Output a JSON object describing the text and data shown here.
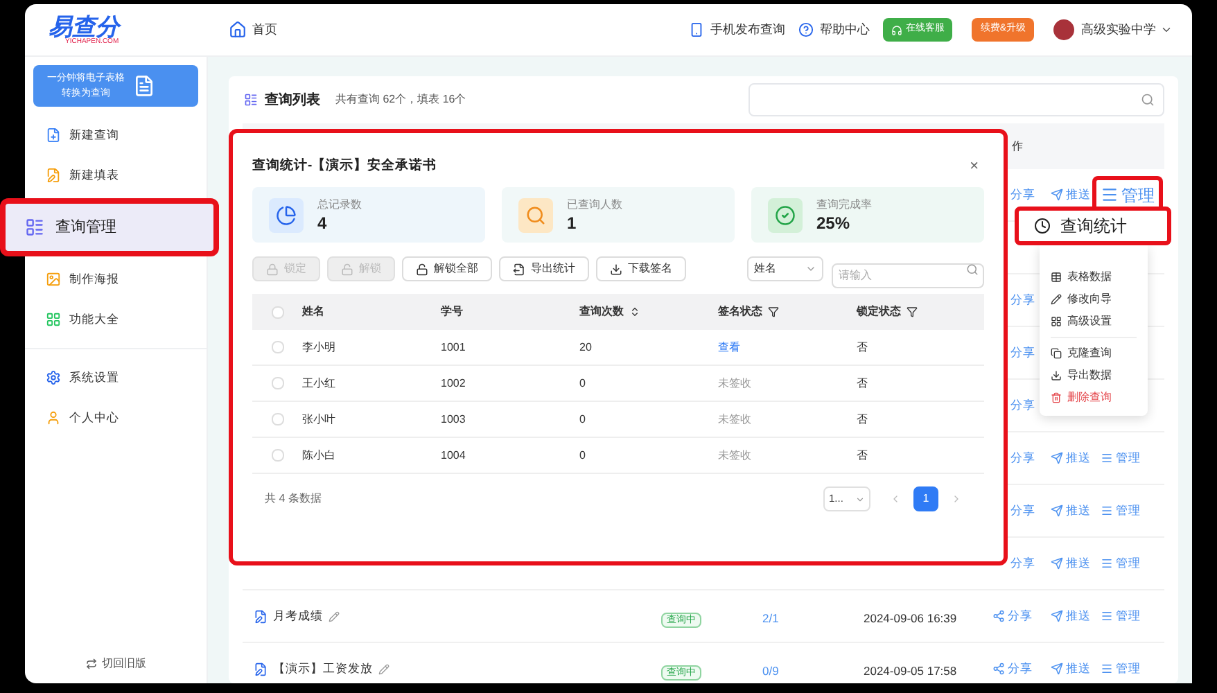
{
  "header": {
    "logo": {
      "name": "易查分",
      "domain": "YICHAPEN.COM"
    },
    "breadcrumb": "首页",
    "links": [
      {
        "label": "手机发布查询",
        "kind": "phone"
      },
      {
        "label": "帮助中心",
        "kind": "help"
      }
    ],
    "buttons": [
      {
        "label": "在线客服",
        "kind": "service"
      },
      {
        "label": "续费&升级",
        "kind": "upgrade"
      }
    ],
    "account": "高级实验中学"
  },
  "sidebar": {
    "banner": [
      "一分钟将电子表格",
      "转换为查询"
    ],
    "groups": [
      [
        {
          "label": "新建查询",
          "kind": "new-query",
          "selected": false
        },
        {
          "label": "新建填表",
          "kind": "new-form",
          "selected": false
        },
        {
          "label": "查询管理",
          "kind": "manage",
          "selected": true
        },
        {
          "label": "制作海报",
          "kind": "poster",
          "selected": false
        },
        {
          "label": "功能大全",
          "kind": "features",
          "selected": false
        }
      ],
      [
        {
          "label": "系统设置",
          "kind": "settings",
          "selected": false
        },
        {
          "label": "个人中心",
          "kind": "profile",
          "selected": false
        }
      ]
    ],
    "footer": "切回旧版"
  },
  "list": {
    "title": "查询列表",
    "summary": "共有查询 62个，填表 16个",
    "column_partial": "作",
    "rows": [
      {
        "actions": [
          {
            "label": "分享",
            "icon": false,
            "highlighted": false
          },
          {
            "label": "推送",
            "icon": true,
            "highlighted": false
          },
          {
            "label": "管理",
            "icon": true,
            "highlighted": true
          }
        ]
      },
      {
        "actions": []
      },
      {
        "actions": [
          {
            "label": "分享",
            "icon": false,
            "highlighted": false
          }
        ]
      },
      {
        "actions": [
          {
            "label": "分享",
            "icon": false,
            "highlighted": false
          }
        ]
      },
      {
        "actions": [
          {
            "label": "分享",
            "icon": false,
            "highlighted": false
          }
        ]
      },
      {
        "actions": [
          {
            "label": "分享",
            "icon": false,
            "highlighted": false
          },
          {
            "label": "推送",
            "icon": true,
            "highlighted": false
          },
          {
            "label": "管理",
            "icon": true,
            "highlighted": false
          }
        ]
      },
      {
        "actions": [
          {
            "label": "分享",
            "icon": false,
            "highlighted": false
          },
          {
            "label": "推送",
            "icon": true,
            "highlighted": false
          },
          {
            "label": "管理",
            "icon": true,
            "highlighted": false
          }
        ]
      },
      {
        "actions": [
          {
            "label": "分享",
            "icon": false,
            "highlighted": false
          },
          {
            "label": "推送",
            "icon": true,
            "highlighted": false
          },
          {
            "label": "管理",
            "icon": true,
            "highlighted": false
          }
        ]
      },
      {
        "title": "月考成绩",
        "status": "查询中",
        "count": "2/1",
        "date": "2024-09-06 16:39",
        "actions": [
          {
            "label": "分享",
            "icon": true,
            "highlighted": false
          },
          {
            "label": "推送",
            "icon": true,
            "highlighted": false
          },
          {
            "label": "管理",
            "icon": true,
            "highlighted": false
          }
        ]
      },
      {
        "title": "【演示】工资发放",
        "status": "查询中",
        "count": "0/9",
        "date": "2024-09-05 17:58",
        "actions": [
          {
            "label": "分享",
            "icon": true,
            "highlighted": false
          },
          {
            "label": "推送",
            "icon": true,
            "highlighted": false
          },
          {
            "label": "管理",
            "icon": true,
            "highlighted": false
          }
        ]
      }
    ]
  },
  "dialog": {
    "title": "查询统计-【演示】安全承诺书",
    "close": "×",
    "stats": [
      {
        "label": "总记录数",
        "value": "4",
        "kind": "records"
      },
      {
        "label": "已查询人数",
        "value": "1",
        "kind": "queried"
      },
      {
        "label": "查询完成率",
        "value": "25%",
        "kind": "rate"
      }
    ],
    "toolbar": [
      {
        "label": "锁定",
        "kind": "lock",
        "disabled": true
      },
      {
        "label": "解锁",
        "kind": "unlock",
        "disabled": true
      },
      {
        "label": "解锁全部",
        "kind": "unlock",
        "disabled": false
      },
      {
        "label": "导出统计",
        "kind": "export",
        "disabled": false
      },
      {
        "label": "下载签名",
        "kind": "download",
        "disabled": false
      }
    ],
    "filter": "姓名",
    "search": {
      "placeholder": "请输入"
    },
    "columns": [
      {
        "label": "姓名",
        "kind": "plain"
      },
      {
        "label": "学号",
        "kind": "plain"
      },
      {
        "label": "查询次数",
        "kind": "sort"
      },
      {
        "label": "签名状态",
        "kind": "filter"
      },
      {
        "label": "锁定状态",
        "kind": "filter"
      }
    ],
    "header_checked": false,
    "rows": [
      {
        "checked": false,
        "cells": [
          "李小明",
          "1001",
          "20",
          "查看",
          "否"
        ],
        "signed": true
      },
      {
        "checked": false,
        "cells": [
          "王小红",
          "1002",
          "0",
          "未签收",
          "否"
        ],
        "signed": false
      },
      {
        "checked": false,
        "cells": [
          "张小叶",
          "1003",
          "0",
          "未签收",
          "否"
        ],
        "signed": false
      },
      {
        "checked": false,
        "cells": [
          "陈小白",
          "1004",
          "0",
          "未签收",
          "否"
        ],
        "signed": false
      }
    ],
    "total": "共 4 条数据",
    "page_size": "1...",
    "pages": [
      {
        "label": "1",
        "selected": true
      }
    ]
  },
  "menu": {
    "highlighted": "查询统计",
    "items": [
      {
        "label": "表格数据",
        "kind": "table",
        "divider": false
      },
      {
        "label": "修改向导",
        "kind": "edit",
        "divider": false
      },
      {
        "label": "高级设置",
        "kind": "grid",
        "divider": false
      },
      {
        "label": "克隆查询",
        "kind": "copy",
        "divider": true
      },
      {
        "label": "导出数据",
        "kind": "download",
        "divider": false
      },
      {
        "label": "删除查询",
        "kind": "delete",
        "divider": false
      }
    ]
  }
}
